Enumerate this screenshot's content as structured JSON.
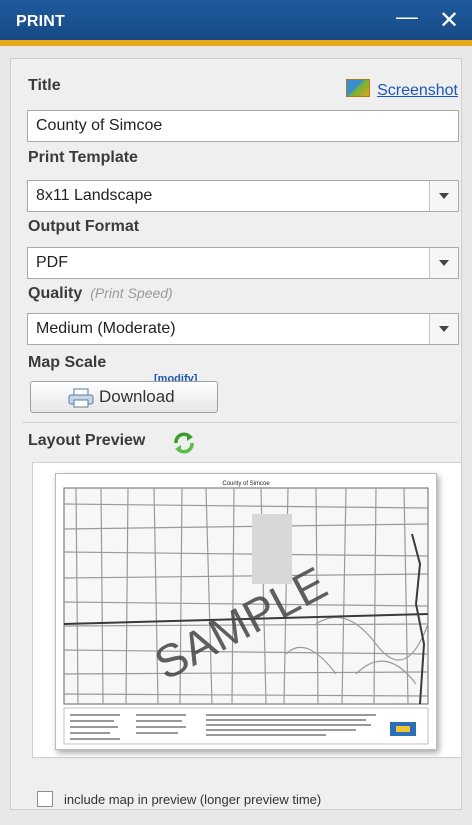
{
  "window": {
    "title": "PRINT",
    "minimize_glyph": "—",
    "close_glyph": "✕"
  },
  "form": {
    "title_label": "Title",
    "screenshot_link": "Screenshot",
    "title_value": "County of Simcoe",
    "template_label": "Print Template",
    "template_value": "8x11 Landscape",
    "format_label": "Output Format",
    "format_value": "PDF",
    "quality_label": "Quality",
    "quality_hint": "(Print Speed)",
    "quality_value": "Medium (Moderate)",
    "scale_label": "Map Scale",
    "modify_link": "[modify]",
    "download_label": "Download"
  },
  "preview": {
    "label": "Layout Preview",
    "map_title": "County of Simcoe",
    "watermark": "SAMPLE",
    "include_map_label": "include map in preview (longer preview  time)",
    "include_map_checked": false
  },
  "icons": {
    "screenshot": "screenshot-icon",
    "printer": "printer-icon",
    "refresh": "refresh-icon",
    "dropdown": "chevron-down-icon"
  },
  "colors": {
    "titlebar": "#1b5393",
    "accent": "#e8a91b",
    "link": "#1a57b8"
  }
}
